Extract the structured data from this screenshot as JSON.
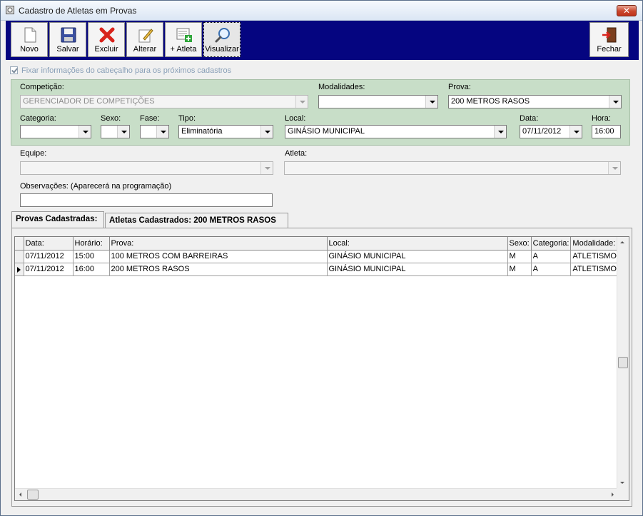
{
  "window": {
    "title": "Cadastro de Atletas em Provas",
    "close_glyph": "✕"
  },
  "toolbar": {
    "buttons": [
      {
        "label": "Novo",
        "icon": "new-document-icon"
      },
      {
        "label": "Salvar",
        "icon": "floppy-disk-icon"
      },
      {
        "label": "Excluir",
        "icon": "red-x-icon"
      },
      {
        "label": "Alterar",
        "icon": "edit-pencil-icon"
      },
      {
        "label": "+ Atleta",
        "icon": "add-athlete-icon"
      },
      {
        "label": "Visualizar",
        "icon": "magnifier-icon"
      }
    ],
    "fechar": {
      "label": "Fechar",
      "icon": "exit-door-icon"
    }
  },
  "fix_header": {
    "label": "Fixar informações do cabeçalho para os próximos cadastros",
    "checked": true
  },
  "form": {
    "competicao": {
      "label": "Competição:",
      "value": "GERENCIADOR DE COMPETIÇÕES"
    },
    "modalidades": {
      "label": "Modalidades:",
      "value": ""
    },
    "prova": {
      "label": "Prova:",
      "value": "200 METROS RASOS"
    },
    "categoria": {
      "label": "Categoria:",
      "value": ""
    },
    "sexo": {
      "label": "Sexo:",
      "value": ""
    },
    "fase": {
      "label": "Fase:",
      "value": ""
    },
    "tipo": {
      "label": "Tipo:",
      "value": "Eliminatória"
    },
    "local": {
      "label": "Local:",
      "value": "GINÁSIO MUNICIPAL"
    },
    "data": {
      "label": "Data:",
      "value": "07/11/2012"
    },
    "hora": {
      "label": "Hora:",
      "value": "16:00"
    },
    "equipe": {
      "label": "Equipe:",
      "value": ""
    },
    "atleta": {
      "label": "Atleta:",
      "value": ""
    },
    "observacoes": {
      "label": "Observações: (Aparecerá na programação)",
      "value": ""
    }
  },
  "tabs": [
    {
      "label": "Provas Cadastradas:",
      "active": true
    },
    {
      "label": "Atletas Cadastrados: 200 METROS RASOS",
      "active": false
    }
  ],
  "grid": {
    "columns": [
      "Data:",
      "Horário:",
      "Prova:",
      "Local:",
      "Sexo:",
      "Categoria:",
      "Modalidade:"
    ],
    "rows": [
      [
        "07/11/2012",
        "15:00",
        "100 METROS COM BARREIRAS",
        "GINÁSIO MUNICIPAL",
        "M",
        "A",
        "ATLETISMO"
      ],
      [
        "07/11/2012",
        "16:00",
        "200 METROS RASOS",
        "GINÁSIO MUNICIPAL",
        "M",
        "A",
        "ATLETISMO"
      ]
    ],
    "selected_row": 1
  }
}
